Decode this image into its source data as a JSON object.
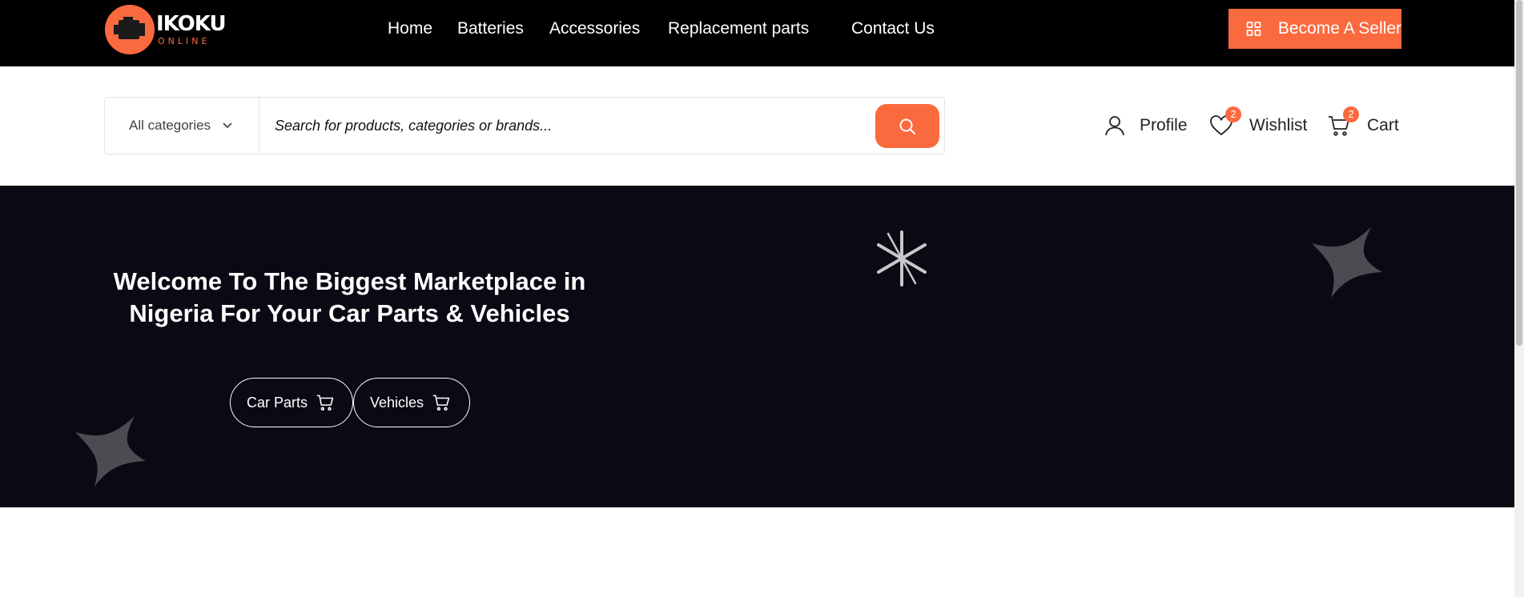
{
  "brand": {
    "name": "IKOKU",
    "tagline": "ONLINE",
    "accent": "#fb6a3f",
    "logo_icon": "engine-icon"
  },
  "nav": {
    "items": [
      {
        "label": "Home"
      },
      {
        "label": "Batteries"
      },
      {
        "label": "Accessories"
      },
      {
        "label": "Replacement parts"
      },
      {
        "label": "Contact Us"
      }
    ],
    "cta": {
      "label": "Become A Seller",
      "icon": "grid-icon"
    }
  },
  "search": {
    "category_label": "All categories",
    "placeholder": "Search for products, categories or brands...",
    "value": ""
  },
  "account": {
    "profile_label": "Profile",
    "wishlist_label": "Wishlist",
    "wishlist_count": "2",
    "cart_label": "Cart",
    "cart_count": "2"
  },
  "hero": {
    "title": "Welcome To The Biggest Marketplace in Nigeria For Your Car Parts & Vehicles",
    "buttons": [
      {
        "label": "Car Parts",
        "icon": "cart-icon"
      },
      {
        "label": "Vehicles",
        "icon": "cart-icon"
      }
    ],
    "background": "#0a0a14"
  }
}
